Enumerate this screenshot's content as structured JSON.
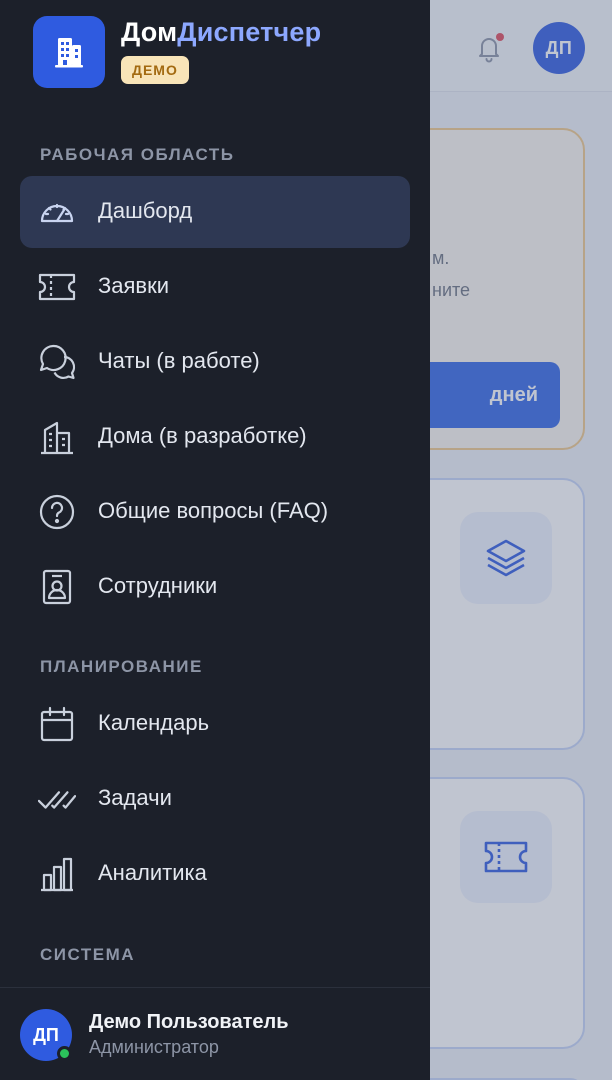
{
  "brand": {
    "name_part1": "Дом",
    "name_part2": "Диспетчер",
    "badge": "ДЕМО"
  },
  "header": {
    "avatar_initials": "ДП"
  },
  "background": {
    "promo_lines": [
      "м.",
      "ните"
    ],
    "promo_button": "дней"
  },
  "sections": [
    {
      "label": "РАБОЧАЯ ОБЛАСТЬ"
    },
    {
      "label": "ПЛАНИРОВАНИЕ"
    },
    {
      "label": "СИСТЕМА"
    }
  ],
  "nav": [
    {
      "label": "Дашборд",
      "icon": "gauge-icon",
      "active": true
    },
    {
      "label": "Заявки",
      "icon": "ticket-icon"
    },
    {
      "label": "Чаты (в работе)",
      "icon": "chat-icon"
    },
    {
      "label": "Дома (в разработке)",
      "icon": "buildings-icon"
    },
    {
      "label": "Общие вопросы (FAQ)",
      "icon": "question-icon"
    },
    {
      "label": "Сотрудники",
      "icon": "badge-icon"
    },
    {
      "label": "Календарь",
      "icon": "calendar-icon"
    },
    {
      "label": "Задачи",
      "icon": "double-check-icon"
    },
    {
      "label": "Аналитика",
      "icon": "bar-chart-icon"
    }
  ],
  "user": {
    "initials": "ДП",
    "name": "Демо Пользователь",
    "role": "Администратор",
    "status": "online"
  },
  "colors": {
    "accent": "#2f5be0",
    "drawer_bg": "#1c202a",
    "active_item": "#2e3853",
    "badge_bg": "#f8e4b8",
    "online": "#2bc25b"
  }
}
